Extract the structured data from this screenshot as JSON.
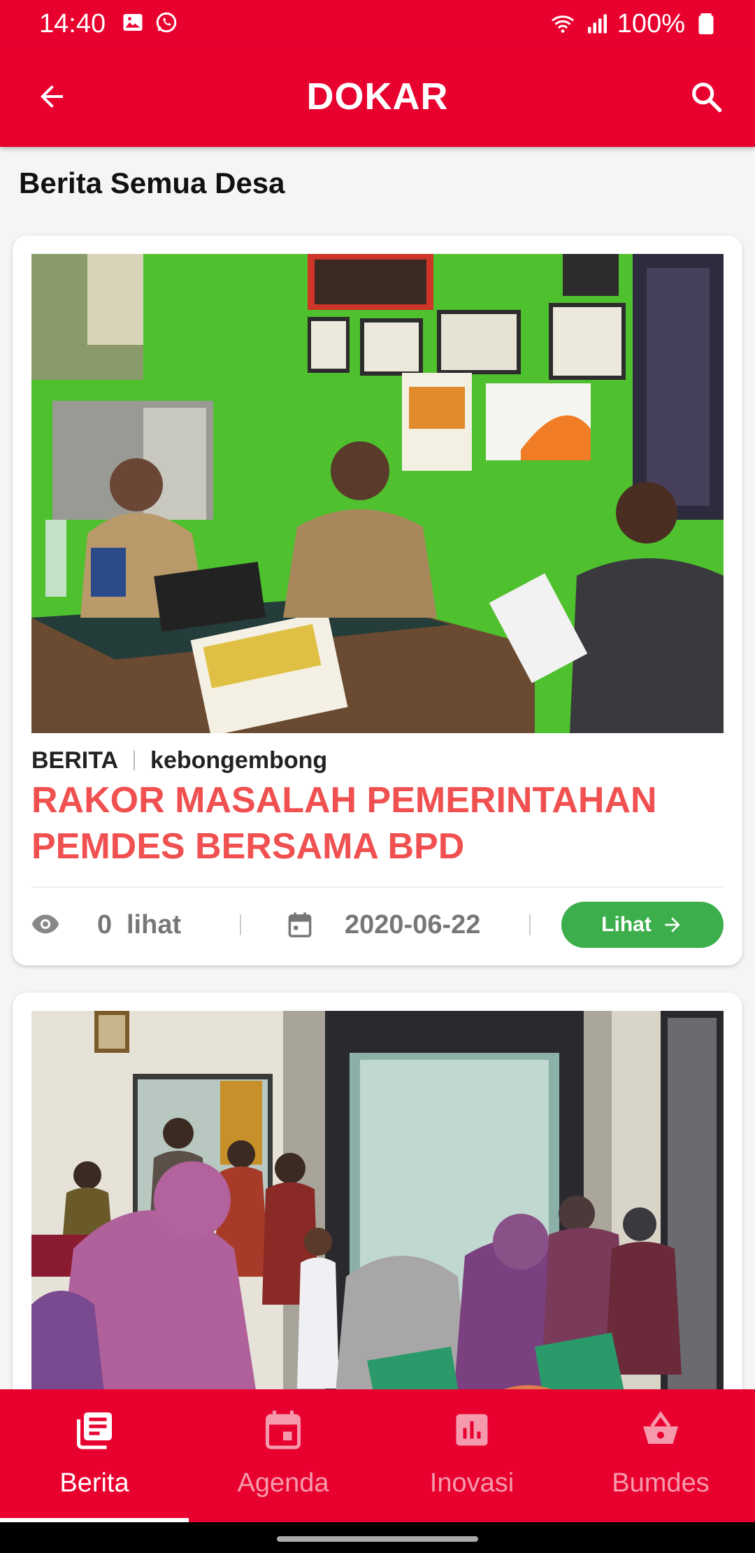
{
  "status_bar": {
    "time": "14:40",
    "battery": "100%"
  },
  "app_bar": {
    "title": "DOKAR"
  },
  "section_title": "Berita Semua Desa",
  "news": [
    {
      "category": "BERITA",
      "village": "kebongembong",
      "title": "RAKOR MASALAH PEMERINTAHAN PEMDES BERSAMA BPD",
      "views": "0",
      "views_label": "lihat",
      "date": "2020-06-22",
      "button_label": "Lihat"
    }
  ],
  "bottom_nav": {
    "items": [
      {
        "label": "Berita",
        "icon": "newspaper-icon",
        "active": true
      },
      {
        "label": "Agenda",
        "icon": "calendar-icon",
        "active": false
      },
      {
        "label": "Inovasi",
        "icon": "bar-chart-icon",
        "active": false
      },
      {
        "label": "Bumdes",
        "icon": "basket-icon",
        "active": false
      }
    ]
  },
  "colors": {
    "primary": "#e8002f",
    "title_red": "#f05050",
    "button_green": "#3cae4b"
  }
}
